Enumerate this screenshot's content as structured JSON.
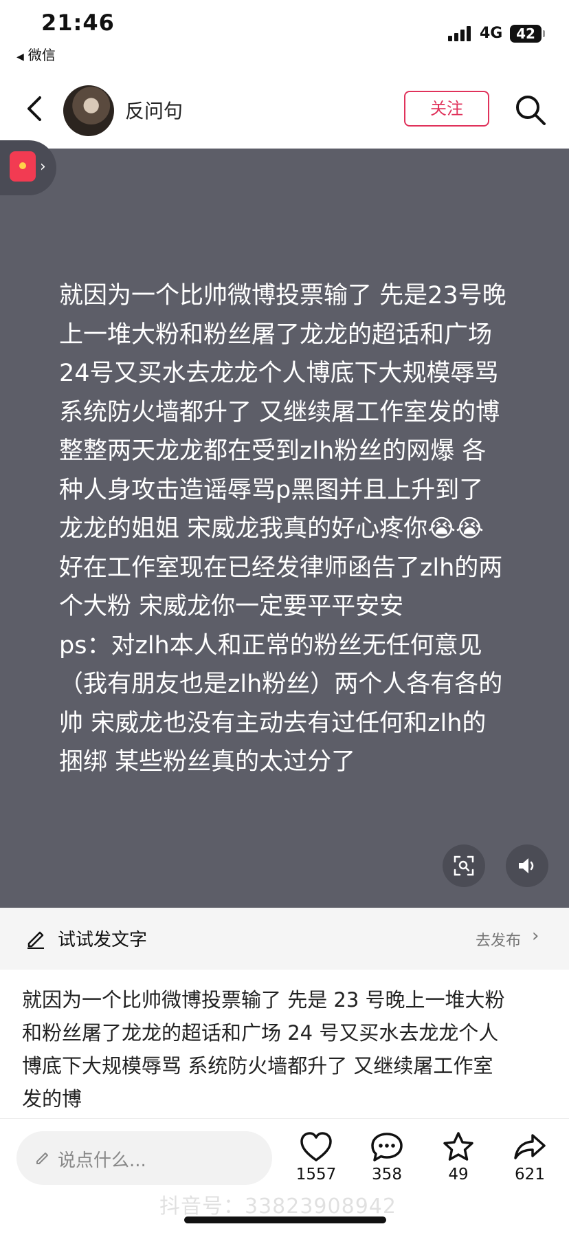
{
  "status_bar": {
    "time": "21:46",
    "back_app": "微信",
    "network": "4G",
    "battery": "42"
  },
  "header": {
    "username": "反问句",
    "follow_label": "关注"
  },
  "post": {
    "lines": [
      "就因为一个比帅微博投票输了 先是23号晚",
      "上一堆大粉和粉丝屠了龙龙的超话和广场",
      "24号又买水去龙龙个人博底下大规模辱骂",
      "系统防火墙都升了 又继续屠工作室发的博",
      "整整两天龙龙都在受到zlh粉丝的网爆 各",
      "种人身攻击造谣辱骂p黑图并且上升到了",
      "龙龙的姐姐 宋威龙我真的好心疼你😭😭",
      "好在工作室现在已经发律师函告了zlh的两",
      "个大粉 宋威龙你一定要平平安安",
      "ps：对zlh本人和正常的粉丝无任何意见",
      "（我有朋友也是zlh粉丝）两个人各有各的",
      "帅 宋威龙也没有主动去有过任何和zlh的",
      "捆绑 某些粉丝真的太过分了"
    ]
  },
  "try_bar": {
    "label": "试试发文字",
    "publish": "去发布"
  },
  "caption": {
    "lines": [
      "就因为一个比帅微博投票输了 先是 23 号晚上一堆大粉",
      "和粉丝屠了龙龙的超话和广场 24 号又买水去龙龙个人",
      "博底下大规模辱骂 系统防火墙都升了 又继续屠工作室",
      "发的博"
    ]
  },
  "bottom_bar": {
    "comment_placeholder": "说点什么...",
    "likes": "1557",
    "comments": "358",
    "favorites": "49",
    "shares": "621",
    "watermark": "抖音号：33823908942"
  },
  "colors": {
    "accent": "#e0325b",
    "content_bg": "#5d5e68"
  }
}
